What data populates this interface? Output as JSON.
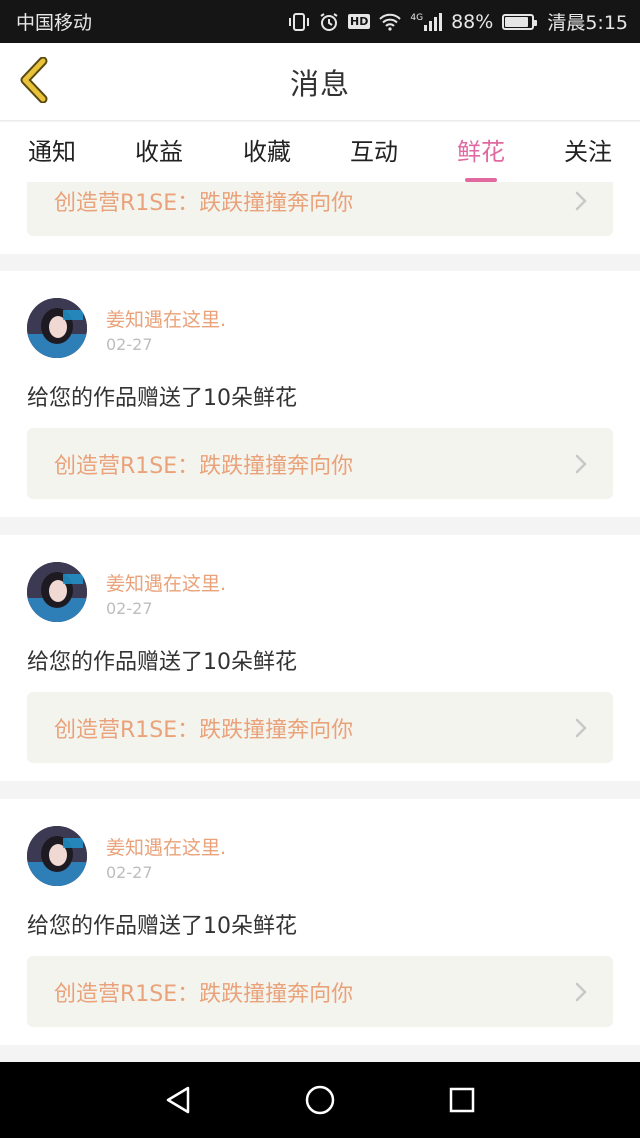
{
  "status_bar": {
    "carrier": "中国移动",
    "network": "4G",
    "battery": "88%",
    "battery_level": 0.88,
    "time": "清晨5:15",
    "icons": [
      "vibrate-icon",
      "alarm-icon",
      "hd-icon",
      "wifi-icon",
      "signal-icon",
      "battery-icon"
    ]
  },
  "header": {
    "back_icon": "chevron-left-icon",
    "title": "消息"
  },
  "tabs": [
    {
      "label": "通知",
      "active": false
    },
    {
      "label": "收益",
      "active": false
    },
    {
      "label": "收藏",
      "active": false
    },
    {
      "label": "互动",
      "active": false
    },
    {
      "label": "鲜花",
      "active": true
    },
    {
      "label": "关注",
      "active": false
    }
  ],
  "feed": {
    "partial_top": {
      "link_text": "创造营R1SE：跌跌撞撞奔向你"
    },
    "items": [
      {
        "username": "姜知遇在这里.",
        "date": "02-27",
        "message": "给您的作品赠送了10朵鲜花",
        "link_text": "创造营R1SE：跌跌撞撞奔向你"
      },
      {
        "username": "姜知遇在这里.",
        "date": "02-27",
        "message": "给您的作品赠送了10朵鲜花",
        "link_text": "创造营R1SE：跌跌撞撞奔向你"
      },
      {
        "username": "姜知遇在这里.",
        "date": "02-27",
        "message": "给您的作品赠送了10朵鲜花",
        "link_text": "创造营R1SE：跌跌撞撞奔向你"
      }
    ]
  },
  "system_nav": {
    "buttons": [
      "back-triangle-icon",
      "home-circle-icon",
      "recents-square-icon"
    ]
  },
  "colors": {
    "accent_pink": "#e06aa0",
    "link_orange": "#e9a27a",
    "link_bg": "#f4f4ee",
    "back_arrow_gold": "#e8c23a"
  }
}
